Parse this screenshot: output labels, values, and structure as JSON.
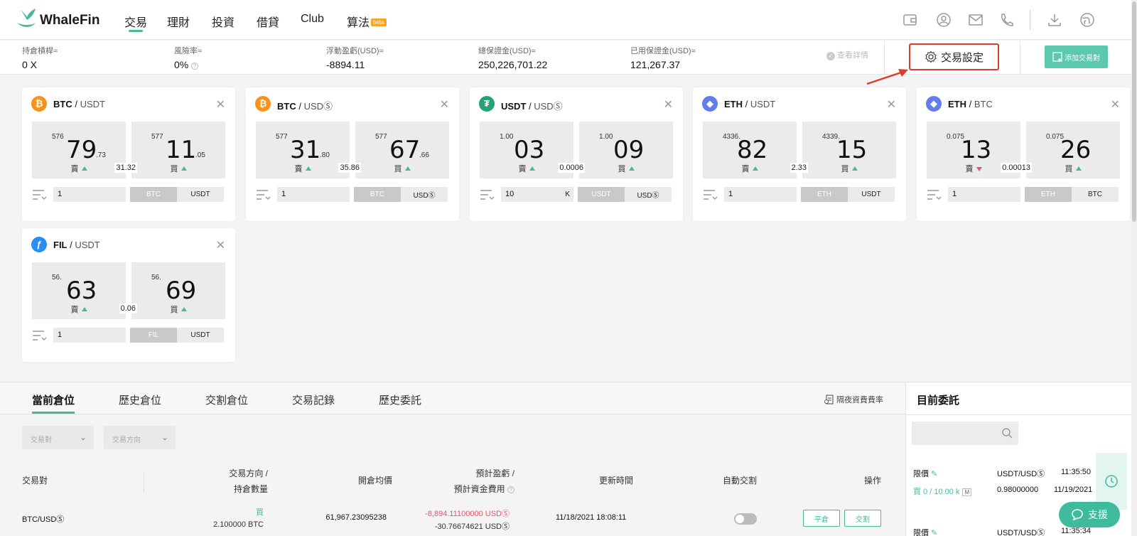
{
  "brand": {
    "name": "WhaleFin",
    "accent": "#44b9a0",
    "highlight": "#e0392e"
  },
  "nav": {
    "items": [
      {
        "label": "交易"
      },
      {
        "label": "理財"
      },
      {
        "label": "投資"
      },
      {
        "label": "借貸"
      },
      {
        "label": "Club"
      },
      {
        "label": "算法"
      }
    ],
    "beta_label": "beta",
    "icons": [
      "wallet-icon",
      "user-icon",
      "mail-icon",
      "phone-icon",
      "download-icon",
      "globe-icon"
    ]
  },
  "stats": {
    "leverage": {
      "label": "持倉槓桿",
      "value": "0 X"
    },
    "risk": {
      "label": "風險率",
      "value": "0%"
    },
    "pnl": {
      "label": "浮動盈虧(USD)",
      "value": "-8894.11"
    },
    "margin_total": {
      "label": "總保證金(USD)",
      "value": "250,226,701.22"
    },
    "margin_used": {
      "label": "已用保證金(USD)",
      "value": "121,267.37"
    },
    "approx": "≈",
    "detail_label": "查看詳情",
    "settings_label": "交易設定",
    "add_pair_label": "添加交易對"
  },
  "cards": [
    {
      "base": "BTC",
      "quote": "USDT",
      "coin": "btc",
      "sell": {
        "pre": "576",
        "big": "79",
        "suf": ".73",
        "label": "賣",
        "dir": "up"
      },
      "buy": {
        "pre": "577",
        "big": "11",
        "suf": ".05",
        "label": "買",
        "dir": "up"
      },
      "spread": "31.32",
      "qty": "1",
      "qty_unit": "",
      "seg": [
        "BTC",
        "USDT"
      ]
    },
    {
      "base": "BTC",
      "quote": "USDⓈ",
      "coin": "btc",
      "sell": {
        "pre": "577",
        "big": "31",
        "suf": ".80",
        "label": "賣",
        "dir": "up"
      },
      "buy": {
        "pre": "577",
        "big": "67",
        "suf": ".66",
        "label": "買",
        "dir": "up"
      },
      "spread": "35.86",
      "qty": "1",
      "qty_unit": "",
      "seg": [
        "BTC",
        "USDⓈ"
      ]
    },
    {
      "base": "USDT",
      "quote": "USDⓈ",
      "coin": "usdt",
      "sell": {
        "pre": "1.00",
        "big": "03",
        "suf": "",
        "label": "賣",
        "dir": "up"
      },
      "buy": {
        "pre": "1.00",
        "big": "09",
        "suf": "",
        "label": "買",
        "dir": "up"
      },
      "spread": "0.0006",
      "qty": "10",
      "qty_unit": "K",
      "seg": [
        "USDT",
        "USDⓈ"
      ]
    },
    {
      "base": "ETH",
      "quote": "USDT",
      "coin": "eth",
      "sell": {
        "pre": "4336.",
        "big": "82",
        "suf": "",
        "label": "賣",
        "dir": "up"
      },
      "buy": {
        "pre": "4339.",
        "big": "15",
        "suf": "",
        "label": "買",
        "dir": "up"
      },
      "spread": "2.33",
      "qty": "1",
      "qty_unit": "",
      "seg": [
        "ETH",
        "USDT"
      ]
    },
    {
      "base": "ETH",
      "quote": "BTC",
      "coin": "eth",
      "sell": {
        "pre": "0.075",
        "big": "13",
        "suf": "",
        "label": "賣",
        "dir": "down"
      },
      "buy": {
        "pre": "0.075",
        "big": "26",
        "suf": "",
        "label": "買",
        "dir": "up"
      },
      "spread": "0.00013",
      "qty": "1",
      "qty_unit": "",
      "seg": [
        "ETH",
        "BTC"
      ]
    },
    {
      "base": "FIL",
      "quote": "USDT",
      "coin": "fil",
      "sell": {
        "pre": "56.",
        "big": "63",
        "suf": "",
        "label": "賣",
        "dir": "up"
      },
      "buy": {
        "pre": "56.",
        "big": "69",
        "suf": "",
        "label": "買",
        "dir": "up"
      },
      "spread": "0.06",
      "qty": "1",
      "qty_unit": "",
      "seg": [
        "FIL",
        "USDT"
      ]
    }
  ],
  "coin_colors": {
    "btc": "#f7931a",
    "usdt": "#26a17b",
    "eth": "#627eea",
    "fil": "#2a8cf5"
  },
  "bottom": {
    "tabs": [
      "當前倉位",
      "歷史倉位",
      "交割倉位",
      "交易記錄",
      "歷史委託"
    ],
    "funding_label": "隔夜資費費率",
    "filters": [
      "交易對",
      "交易方向"
    ],
    "headers": {
      "pair": "交易對",
      "direction": "交易方向 /",
      "holding": "持倉數量",
      "avg_price": "開倉均價",
      "est_pnl": "預計盈虧 /",
      "est_fee": "預計資金費用",
      "updated": "更新時間",
      "auto": "自動交割",
      "action": "操作"
    },
    "rows": [
      {
        "pair": "BTC/USDⓈ",
        "direction": "買",
        "amount": "2.100000 BTC",
        "avg_price": "61,967.23095238",
        "pnl": "-8,894.11100000 USDⓈ",
        "fee": "-30.76674621 USDⓈ",
        "updated": "11/18/2021 18:08:11",
        "btn_close": "平倉",
        "btn_deliver": "交割"
      }
    ]
  },
  "orders": {
    "title": "目前委託",
    "items": [
      {
        "type": "限價",
        "side_amount": "買 0 / 10.00 k",
        "badge": "M",
        "pair": "USDT/USDⓈ",
        "price": "0.98000000",
        "time": "11:35:50",
        "date": "11/19/2021"
      },
      {
        "type": "限價",
        "pair": "USDT/USDⓈ",
        "time": "11:35:34"
      }
    ]
  },
  "support_label": "支援"
}
